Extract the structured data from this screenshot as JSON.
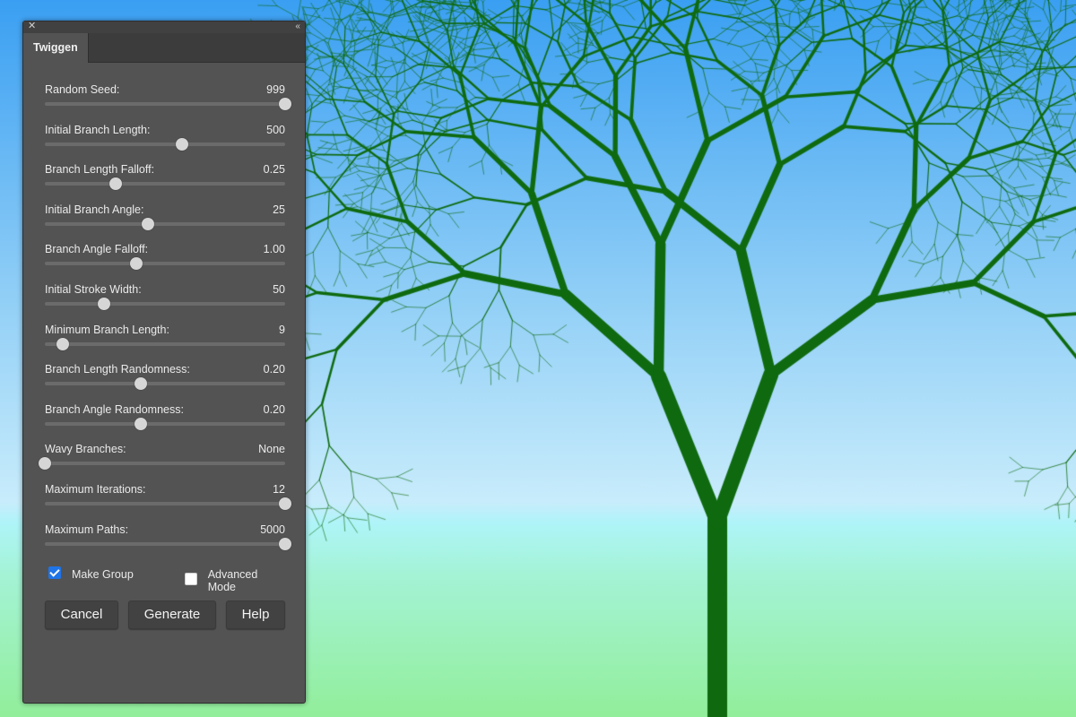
{
  "panel": {
    "tab_label": "Twiggen",
    "close_icon": "close-icon",
    "collapse_icon": "collapse-icon",
    "sliders": [
      {
        "label": "Random Seed:",
        "value": "999",
        "position": 1.0
      },
      {
        "label": "Initial Branch Length:",
        "value": "500",
        "position": 0.57
      },
      {
        "label": "Branch Length Falloff:",
        "value": "0.25",
        "position": 0.295
      },
      {
        "label": "Initial Branch Angle:",
        "value": "25",
        "position": 0.43
      },
      {
        "label": "Branch Angle Falloff:",
        "value": "1.00",
        "position": 0.38
      },
      {
        "label": "Initial Stroke Width:",
        "value": "50",
        "position": 0.245
      },
      {
        "label": "Minimum Branch Length:",
        "value": "9",
        "position": 0.075
      },
      {
        "label": "Branch Length Randomness:",
        "value": "0.20",
        "position": 0.4
      },
      {
        "label": "Branch Angle Randomness:",
        "value": "0.20",
        "position": 0.4
      },
      {
        "label": "Wavy Branches:",
        "value": "None",
        "position": 0.0
      },
      {
        "label": "Maximum Iterations:",
        "value": "12",
        "position": 1.0
      },
      {
        "label": "Maximum Paths:",
        "value": "5000",
        "position": 1.0
      }
    ],
    "make_group": {
      "label": "Make Group",
      "checked": true
    },
    "advanced_mode": {
      "label": "Advanced Mode",
      "checked": false
    },
    "buttons": {
      "cancel": "Cancel",
      "generate": "Generate",
      "help": "Help"
    }
  },
  "canvas": {
    "tree_color": "#0f6a0f",
    "accent_color": "#1f74e8"
  }
}
